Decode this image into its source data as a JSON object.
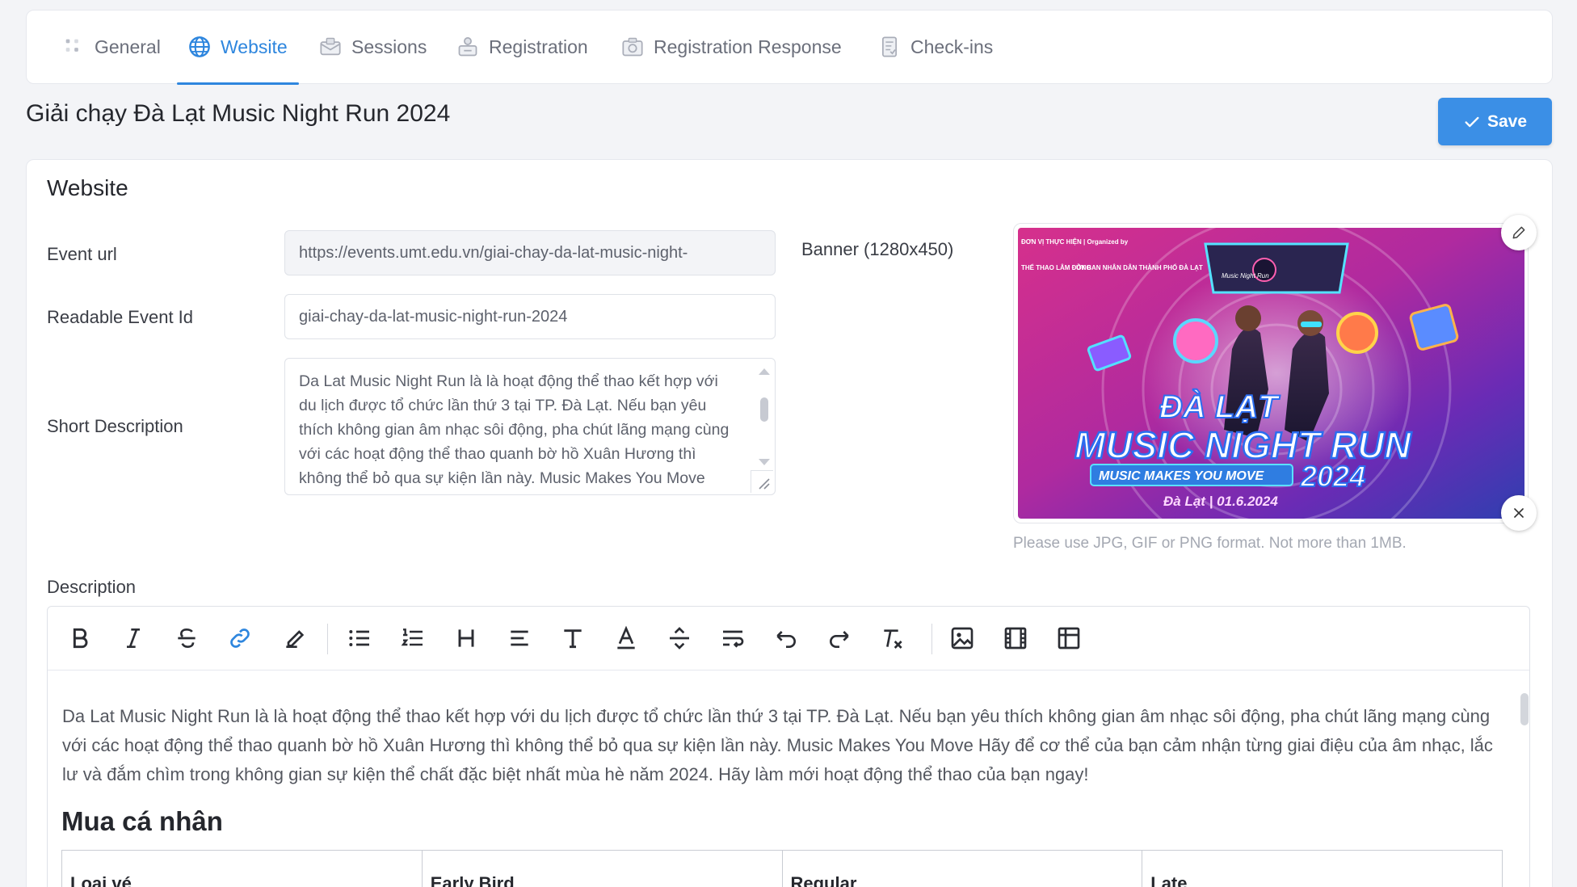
{
  "tabs": [
    {
      "label": "General",
      "icon": "grid-icon",
      "active": false
    },
    {
      "label": "Website",
      "icon": "globe-icon",
      "active": true
    },
    {
      "label": "Sessions",
      "icon": "sessions-icon",
      "active": false
    },
    {
      "label": "Registration",
      "icon": "registration-icon",
      "active": false
    },
    {
      "label": "Registration Response",
      "icon": "camera-icon",
      "active": false
    },
    {
      "label": "Check-ins",
      "icon": "checkin-icon",
      "active": false
    }
  ],
  "page": {
    "title": "Giải chạy Đà Lạt Music Night Run 2024",
    "save_label": "Save"
  },
  "website": {
    "section_title": "Website",
    "event_url_label": "Event url",
    "event_url_value": "https://events.umt.edu.vn/giai-chay-da-lat-music-night-",
    "readable_id_label": "Readable Event Id",
    "readable_id_value": "giai-chay-da-lat-music-night-run-2024",
    "short_desc_label": "Short Description",
    "short_desc_value": "Da Lat Music Night Run là là hoạt động thể thao kết hợp với du lịch được tổ chức lần thứ 3 tại TP. Đà Lạt. Nếu bạn yêu thích không gian âm nhạc sôi động, pha chút lãng mạng cùng với các hoạt động thể thao quanh bờ hồ Xuân Hương thì không thể bỏ qua sự kiện lần này. Music Makes You Move Hãy để cơ thể của bạn cảm nhận từng",
    "banner_label": "Banner (1280x450)",
    "banner_hint": "Please use JPG, GIF or PNG format. Not more than 1MB.",
    "banner": {
      "top_left_text": "ĐƠN VỊ THỰC HIỆN | Organized by",
      "org1": "THỂ THAO LÂM ĐỒNG",
      "org2": "ỦY BAN NHÂN DÂN THÀNH PHỐ ĐÀ LẠT",
      "line1": "ĐÀ LẠT",
      "line2": "MUSIC NIGHT RUN",
      "tagline": "MUSIC MAKES YOU MOVE",
      "year": "2024",
      "place_date": "Đà Lạt | 01.6.2024",
      "logo_text": "Music Night Run"
    },
    "description_label": "Description"
  },
  "editor": {
    "toolbar": [
      "bold-icon",
      "italic-icon",
      "strikethrough-icon",
      "link-icon",
      "highlight-icon",
      "|",
      "bullet-list-icon",
      "ordered-list-icon",
      "heading-icon",
      "align-icon",
      "text-size-icon",
      "text-color-icon",
      "horizontal-rule-icon",
      "wrap-icon",
      "undo-icon",
      "redo-icon",
      "clear-format-icon",
      "|",
      "image-icon",
      "video-icon",
      "table-icon"
    ],
    "body_text": "Da Lat Music Night Run là là hoạt động thể thao kết hợp với du lịch được tổ chức lần thứ 3 tại TP. Đà Lạt. Nếu bạn yêu thích không gian âm nhạc sôi động, pha chút lãng mạng cùng với các hoạt động thể thao quanh bờ hồ Xuân Hương thì không thể bỏ qua sự kiện lần này. Music Makes You Move Hãy để cơ thể của bạn cảm nhận từng giai điệu của âm nhạc, lắc lư và đắm chìm trong không gian sự kiện thể chất đặc biệt nhất mùa hè năm 2024. Hãy làm mới hoạt động thể thao của bạn ngay!",
    "heading": "Mua cá nhân",
    "table_headers": [
      "Loại vé",
      "Early Bird",
      "Regular",
      "Late"
    ]
  },
  "colors": {
    "accent": "#2e86de",
    "save_button": "#3b8fe6",
    "banner_pink": "#e0338f",
    "banner_purple": "#6a2bb5",
    "banner_blue": "#2f7de1"
  }
}
